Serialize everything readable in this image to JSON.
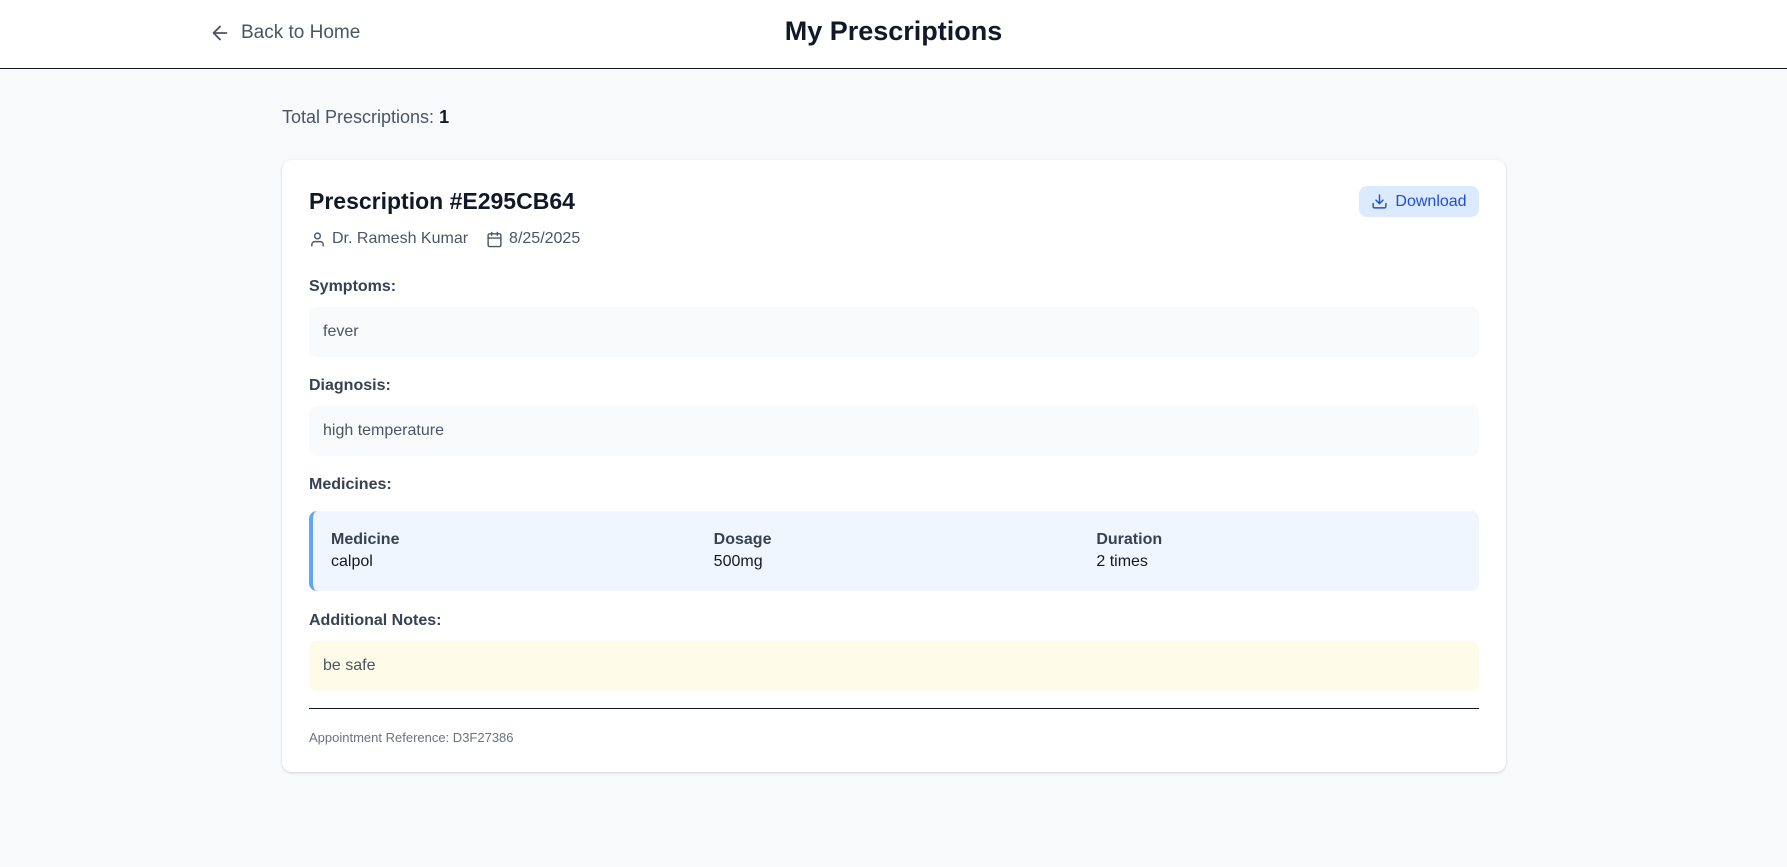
{
  "header": {
    "back_label": "Back to Home",
    "title": "My Prescriptions"
  },
  "summary": {
    "total_label": "Total Prescriptions:",
    "total_value": "1"
  },
  "prescription": {
    "title": "Prescription #E295CB64",
    "doctor": "Dr. Ramesh Kumar",
    "date": "8/25/2025",
    "download_label": "Download",
    "symptoms_label": "Symptoms:",
    "symptoms": "fever",
    "diagnosis_label": "Diagnosis:",
    "diagnosis": "high temperature",
    "medicines_label": "Medicines:",
    "medicines_headers": [
      "Medicine",
      "Dosage",
      "Duration"
    ],
    "medicines": [
      {
        "name": "calpol",
        "dosage": "500mg",
        "duration": "2 times"
      }
    ],
    "notes_label": "Additional Notes:",
    "notes": "be safe",
    "reference": "Appointment Reference: D3F27386"
  },
  "icons": {
    "back": "arrow-left-icon",
    "doctor": "user-icon",
    "date": "calendar-icon",
    "download": "download-icon"
  },
  "colors": {
    "accent": "#1d4ed8",
    "download_bg": "#dbeafe",
    "medicine_bg": "#eff6ff",
    "medicine_border": "#60a5fa",
    "notes_bg": "#fefce8",
    "page_bg": "#f8f9fb"
  }
}
